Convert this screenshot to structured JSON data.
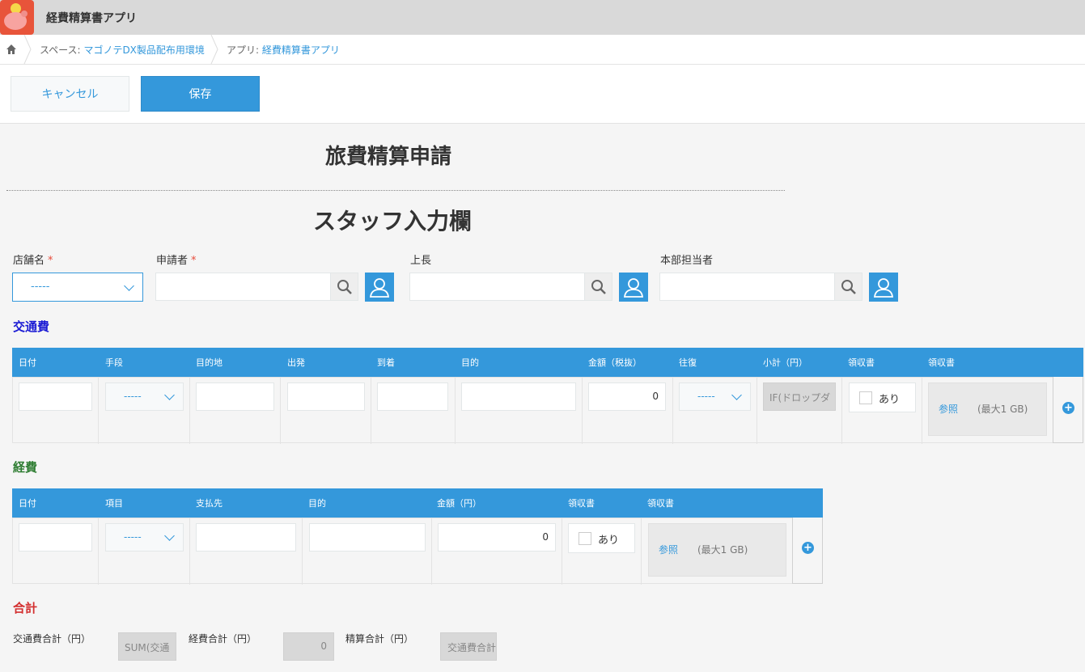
{
  "header": {
    "app_title": "経費精算書アプリ"
  },
  "breadcrumb": {
    "space_label": "スペース:",
    "space_value": "マゴノテDX製品配布用環境",
    "app_label": "アプリ:",
    "app_value": "経費精算書アプリ"
  },
  "toolbar": {
    "cancel_label": "キャンセル",
    "save_label": "保存"
  },
  "form": {
    "title": "旅費精算申請",
    "subtitle": "スタッフ入力欄",
    "required_mark": "*",
    "fields": {
      "store": {
        "label": "店舗名",
        "value": "-----"
      },
      "applicant": {
        "label": "申請者"
      },
      "boss": {
        "label": "上長"
      },
      "hq": {
        "label": "本部担当者"
      }
    }
  },
  "transport": {
    "title": "交通費",
    "title_color": "#1a1ad4",
    "columns": [
      "日付",
      "手段",
      "目的地",
      "出発",
      "到着",
      "目的",
      "金額（税抜）",
      "往復",
      "小計（円）",
      "領収書",
      "領収書"
    ],
    "row": {
      "means": "-----",
      "amount": "0",
      "roundtrip": "-----",
      "subtotal": "IF(ドロップダ",
      "receipt_check": "あり",
      "browse": "参照",
      "max": "(最大1 GB)"
    }
  },
  "expense": {
    "title": "経費",
    "title_color": "#2e7d32",
    "columns": [
      "日付",
      "項目",
      "支払先",
      "目的",
      "金額（円）",
      "領収書",
      "領収書"
    ],
    "row": {
      "item": "-----",
      "amount": "0",
      "receipt_check": "あり",
      "browse": "参照",
      "max": "(最大1 GB)"
    }
  },
  "totals": {
    "title": "合計",
    "title_color": "#d32f2f",
    "transport_label": "交通費合計（円）",
    "transport_value": "SUM(交通",
    "expense_label": "経費合計（円）",
    "expense_value": "0",
    "settle_label": "精算合計（円）",
    "settle_value": "交通費合計"
  },
  "colors": {
    "accent": "#3498db"
  }
}
